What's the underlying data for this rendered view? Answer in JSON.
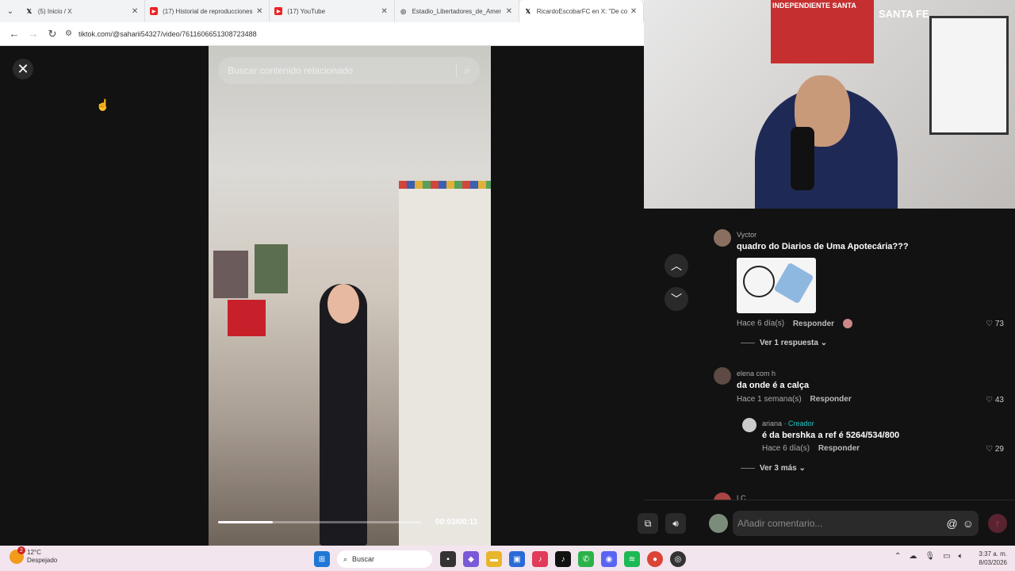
{
  "browser": {
    "tabs": [
      {
        "label": "(5) Inicio / X",
        "icon": "x-logo-icon",
        "active": false
      },
      {
        "label": "(17) Historial de reproducciones",
        "icon": "youtube-icon",
        "active": false
      },
      {
        "label": "(17) YouTube",
        "icon": "youtube-icon",
        "active": false
      },
      {
        "label": "Estadio_Libertadores_de_Amer",
        "icon": "globe-icon",
        "active": false
      },
      {
        "label": "RicardoEscobarFC en X: \"De co",
        "icon": "x-logo-icon",
        "active": false
      }
    ],
    "url": "tiktok.com/@saharii54327/video/7611606651308723488"
  },
  "tiktok": {
    "search_placeholder": "Buscar contenido relacionado",
    "timecode": "00:03/00:11",
    "progress_fraction": 0.27
  },
  "webcam": {
    "banner_text": "INDEPENDIENTE SANTA",
    "badge_text": "SANTA FE"
  },
  "comments": [
    {
      "username": "Vyctor",
      "text": "quadro do Diarios de Uma Apotecária???",
      "time": "Hace 6 día(s)",
      "reply_label": "Responder",
      "likes": "73",
      "view_replies": "Ver 1 respuesta"
    },
    {
      "username": "elena com h",
      "text": "da onde é a calça",
      "time": "Hace 1 semana(s)",
      "reply_label": "Responder",
      "likes": "43",
      "view_replies": "Ver 3 más"
    }
  ],
  "reply": {
    "username": "ariana",
    "creator_label": "· Creador",
    "text": "é da bershka a ref é 5264/534/800",
    "time": "Hace 6 día(s)",
    "reply_label": "Responder",
    "likes": "29"
  },
  "partial_username": "LC",
  "composer": {
    "placeholder": "Añadir comentario..."
  },
  "taskbar": {
    "temperature": "12°C",
    "weather": "Despejado",
    "search_label": "Buscar",
    "weather_badge": "2",
    "time": "3:37 a. m.",
    "date": "8/03/2026"
  },
  "colors": {
    "tiktok_bg": "#121212",
    "creator_accent": "#26c7c7",
    "taskbar": "#f3e5ee"
  }
}
